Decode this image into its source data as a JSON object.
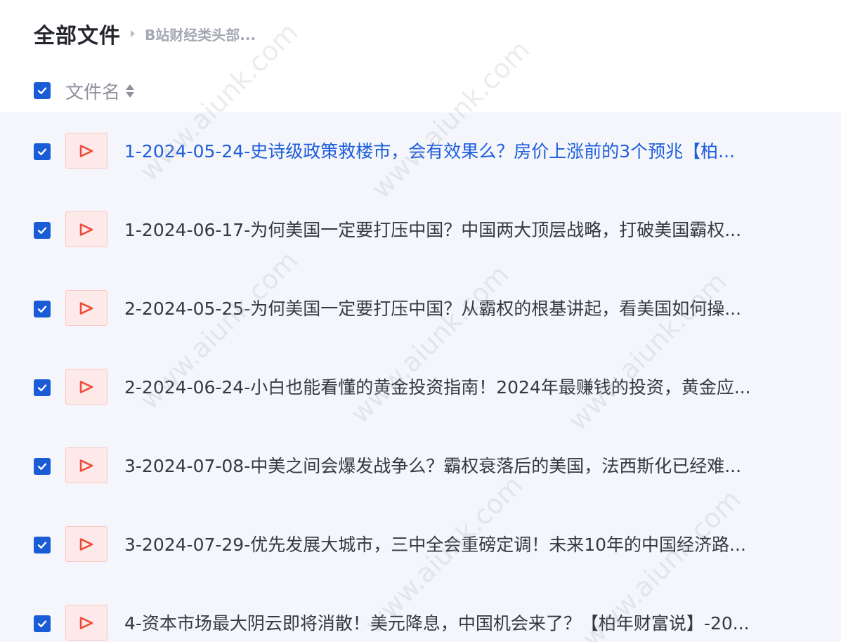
{
  "breadcrumb": {
    "root": "全部文件",
    "current": "B站财经类头部..."
  },
  "list_header": {
    "label": "文件名",
    "checked": true
  },
  "files": [
    {
      "name": "1-2024-05-24-史诗级政策救楼市，会有效果么？房价上涨前的3个预兆【柏...",
      "checked": true,
      "icon": "video-play-icon"
    },
    {
      "name": "1-2024-06-17-为何美国一定要打压中国？中国两大顶层战略，打破美国霸权...",
      "checked": true,
      "icon": "video-play-icon"
    },
    {
      "name": "2-2024-05-25-为何美国一定要打压中国？从霸权的根基讲起，看美国如何操...",
      "checked": true,
      "icon": "video-play-icon"
    },
    {
      "name": "2-2024-06-24-小白也能看懂的黄金投资指南！2024年最赚钱的投资，黄金应...",
      "checked": true,
      "icon": "video-play-icon"
    },
    {
      "name": "3-2024-07-08-中美之间会爆发战争么？霸权衰落后的美国，法西斯化已经难...",
      "checked": true,
      "icon": "video-play-icon"
    },
    {
      "name": "3-2024-07-29-优先发展大城市，三中全会重磅定调！未来10年的中国经济路...",
      "checked": true,
      "icon": "video-play-icon"
    },
    {
      "name": "4-资本市场最大阴云即将消散！美元降息，中国机会来了？【柏年财富说】-20...",
      "checked": true,
      "icon": "video-play-icon"
    }
  ],
  "watermark": "www.aiunk.com",
  "colors": {
    "accent": "#1a5cd6",
    "active_text": "#1c5ddb",
    "list_background": "#f5f6fb",
    "thumb_background": "#fde9e7",
    "play_icon": "#f04a3c"
  }
}
